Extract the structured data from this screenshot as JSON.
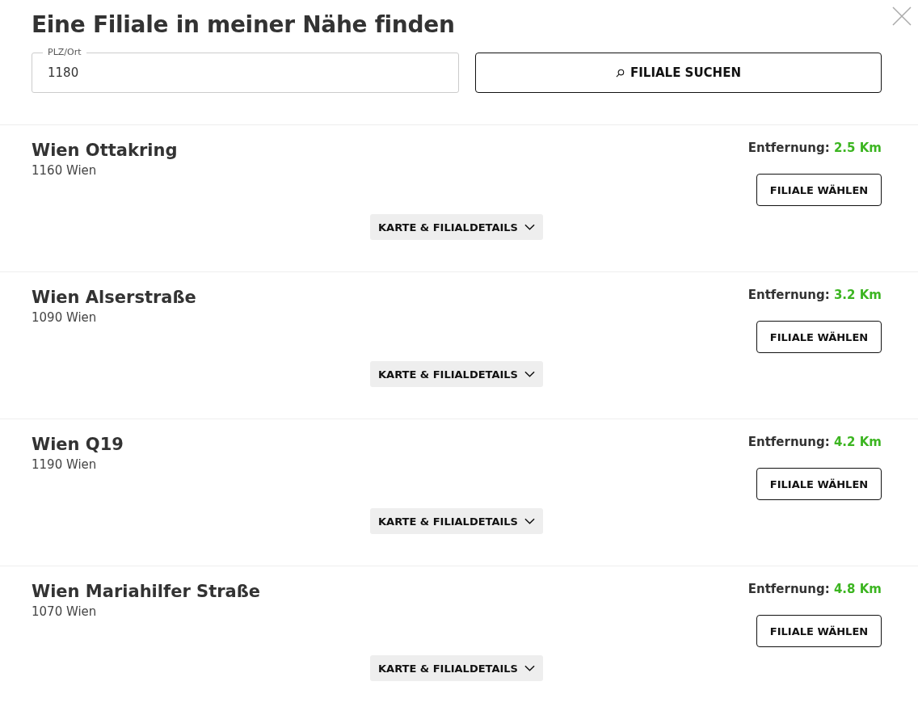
{
  "dialog": {
    "title": "Eine Filiale in meiner Nähe finden"
  },
  "search": {
    "label": "PLZ/Ort",
    "value": "1180",
    "button": "FILIALE SUCHEN"
  },
  "stores": [
    {
      "name": "Wien Ottakring",
      "address": "1160 Wien",
      "distance_label": "Entfernung:",
      "distance": "2.5 Km",
      "select_button": "FILIALE WÄHLEN",
      "details_toggle": "KARTE & FILIALDETAILS",
      "expanded": false
    },
    {
      "name": "Wien Alserstraße",
      "address": "1090 Wien",
      "distance_label": "Entfernung:",
      "distance": "3.2 Km",
      "select_button": "FILIALE WÄHLEN",
      "details_toggle": "KARTE & FILIALDETAILS",
      "expanded": false
    },
    {
      "name": "Wien Q19",
      "address": "1190 Wien",
      "distance_label": "Entfernung:",
      "distance": "4.2 Km",
      "select_button": "FILIALE WÄHLEN",
      "details_toggle": "KARTE & FILIALDETAILS",
      "expanded": false
    },
    {
      "name": "Wien Mariahilfer Straße",
      "address": "1070 Wien",
      "distance_label": "Entfernung:",
      "distance": "4.8 Km",
      "select_button": "FILIALE WÄHLEN",
      "details_toggle": "KARTE & FILIALDETAILS",
      "expanded": false
    }
  ]
}
